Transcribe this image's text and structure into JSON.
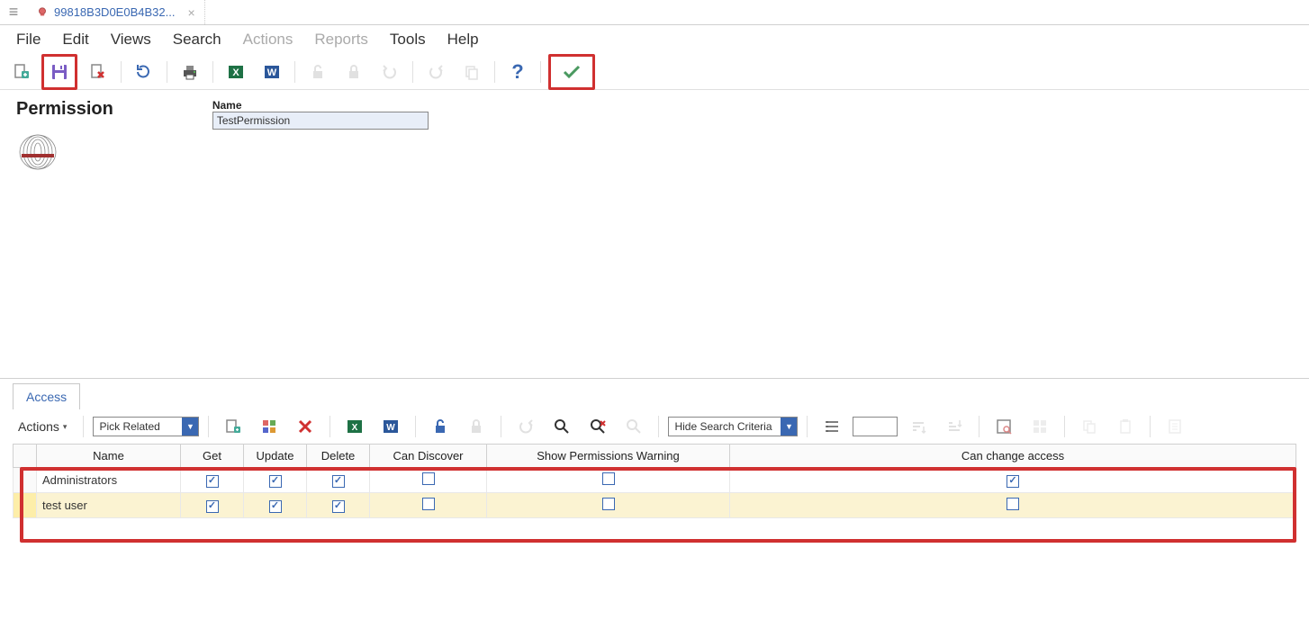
{
  "tab": {
    "title": "99818B3D0E0B4B32..."
  },
  "menu": {
    "file": "File",
    "edit": "Edit",
    "views": "Views",
    "search": "Search",
    "actions": "Actions",
    "reports": "Reports",
    "tools": "Tools",
    "help": "Help"
  },
  "header": {
    "title": "Permission"
  },
  "field": {
    "name_label": "Name",
    "name_value": "TestPermission"
  },
  "subtab": {
    "access": "Access"
  },
  "subtoolbar": {
    "actions_label": "Actions",
    "pick_related": "Pick Related",
    "hide_search": "Hide Search Criteria"
  },
  "table": {
    "headers": {
      "name": "Name",
      "get": "Get",
      "update": "Update",
      "delete": "Delete",
      "discover": "Can Discover",
      "warning": "Show Permissions Warning",
      "change": "Can change access"
    },
    "rows": [
      {
        "name": "Administrators",
        "get": true,
        "update": true,
        "delete": true,
        "discover": false,
        "warning": false,
        "change": true
      },
      {
        "name": "test user",
        "get": true,
        "update": true,
        "delete": true,
        "discover": false,
        "warning": false,
        "change": false
      }
    ]
  }
}
